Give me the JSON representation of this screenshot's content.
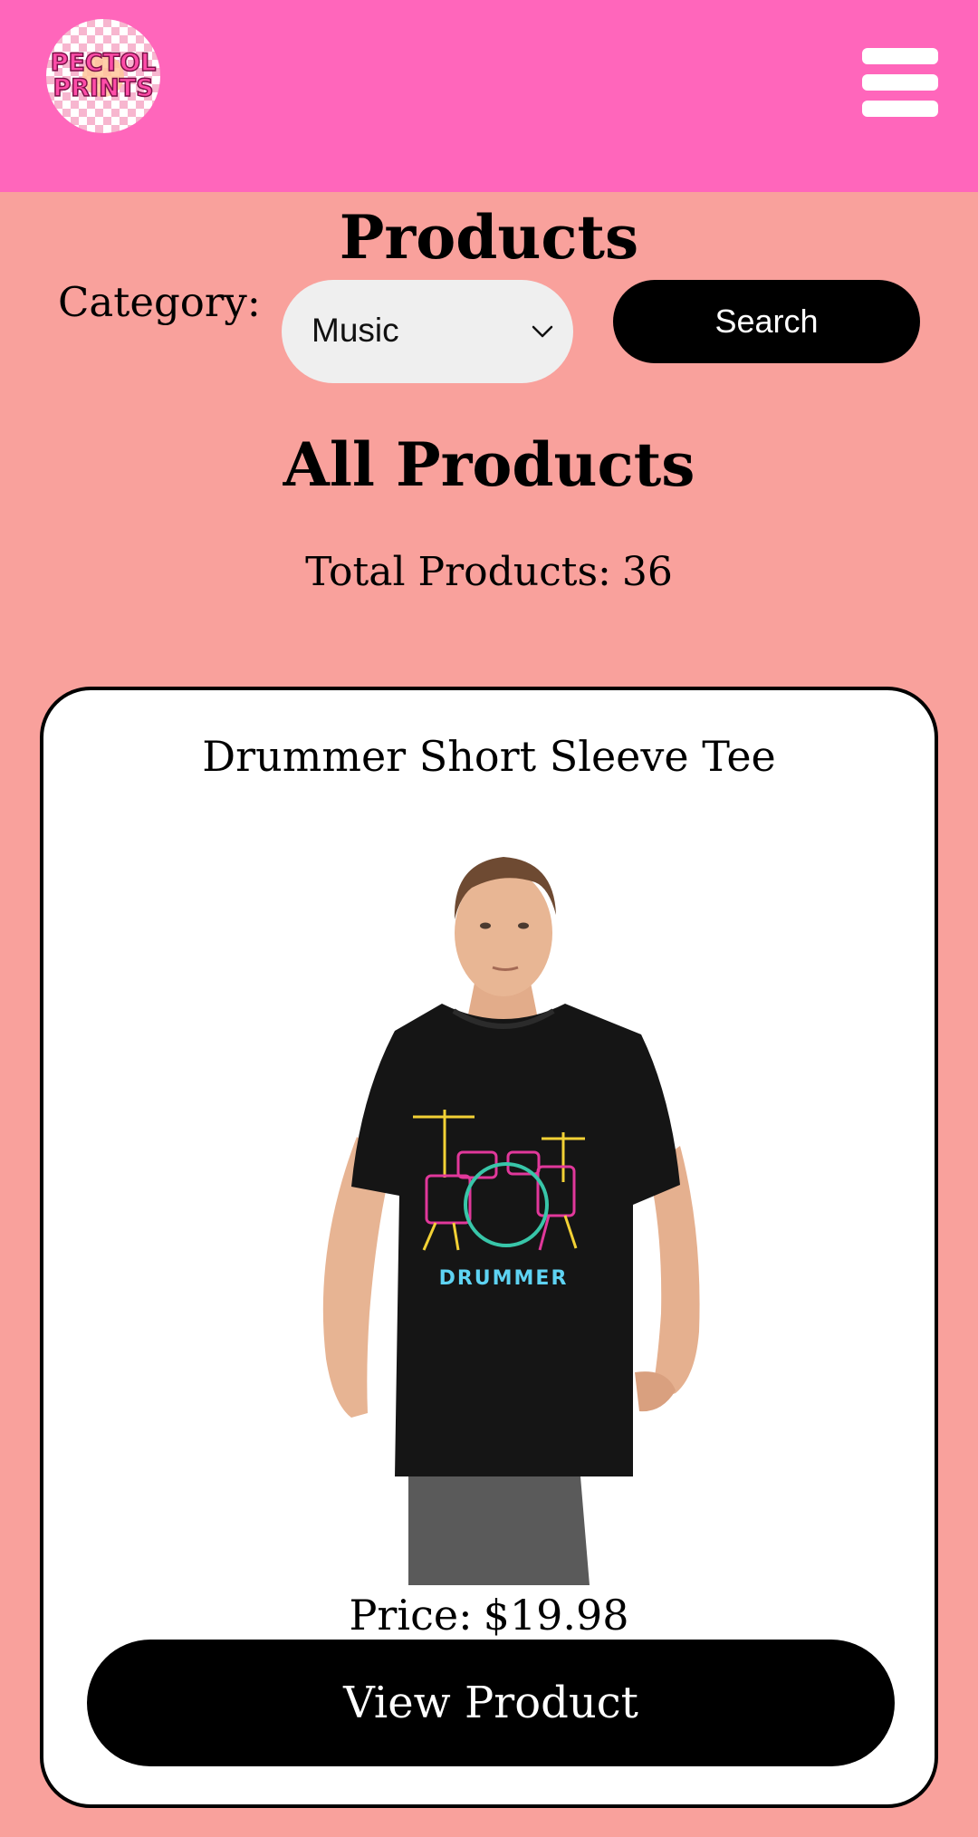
{
  "header": {
    "logo_line1": "PECTOL",
    "logo_line2": "PRINTS",
    "menu_icon": "hamburger-menu-icon",
    "background_color": "#ff66bb"
  },
  "page": {
    "title": "Products",
    "background_color": "#f9a19c"
  },
  "filter": {
    "category_label": "Category:",
    "selected_category": "Music",
    "search_label": "Search"
  },
  "listing": {
    "heading": "All Products",
    "total_label": "Total Products:",
    "total_count": "36"
  },
  "products": [
    {
      "name": "Drummer Short Sleeve Tee",
      "shirt_print_text": "DRUMMER",
      "price_label": "Price:",
      "price": "$19.98",
      "view_label": "View Product"
    }
  ]
}
